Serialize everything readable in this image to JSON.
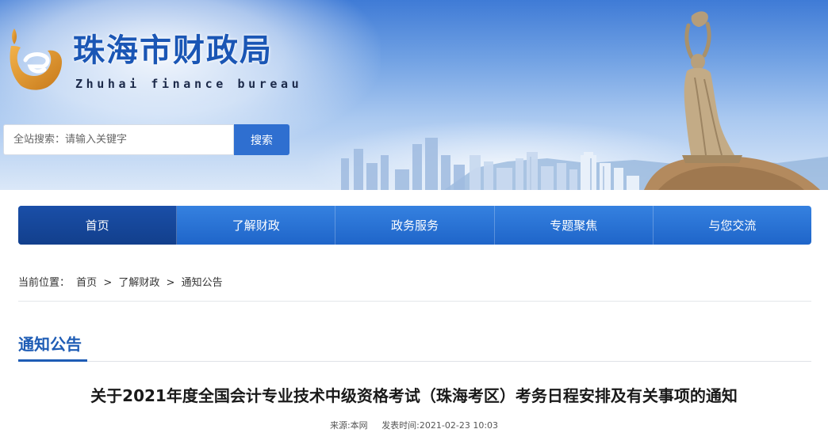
{
  "header": {
    "site_title": "珠海市财政局",
    "site_subtitle": "Zhuhai finance bureau",
    "brand_color": "#1a56b5"
  },
  "search": {
    "placeholder": "全站搜索：请输入关键字",
    "button_label": "搜索"
  },
  "nav": {
    "items": [
      {
        "label": "首页",
        "active": true
      },
      {
        "label": "了解财政",
        "active": false
      },
      {
        "label": "政务服务",
        "active": false
      },
      {
        "label": "专题聚焦",
        "active": false
      },
      {
        "label": "与您交流",
        "active": false
      }
    ]
  },
  "breadcrumb": {
    "prefix": "当前位置：",
    "items": [
      "首页",
      "了解财政",
      "通知公告"
    ],
    "separator": ">"
  },
  "section": {
    "title": "通知公告"
  },
  "article": {
    "title": "关于2021年度全国会计专业技术中级资格考试（珠海考区）考务日程安排及有关事项的通知",
    "source": "来源:本网",
    "published": "发表时间:2021-02-23 10:03"
  },
  "colors": {
    "nav_bg": "#2a6fd4",
    "nav_active": "#163f8c",
    "search_button": "#2f6fd0",
    "section_accent": "#1e5cb5"
  }
}
